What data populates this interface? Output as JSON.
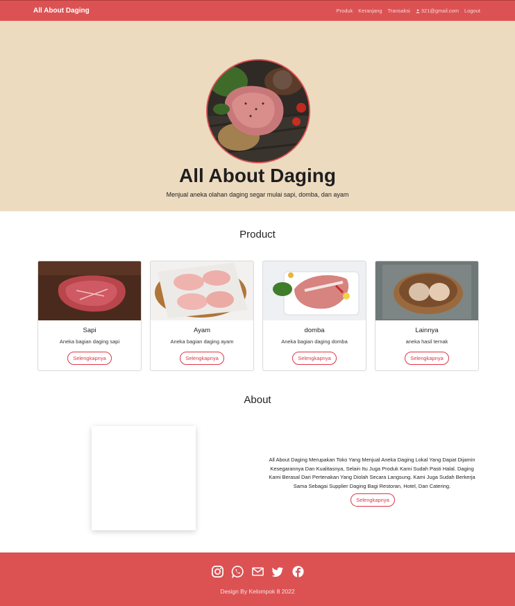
{
  "nav": {
    "brand": "All About Daging",
    "links": [
      "Produk",
      "Keranjang",
      "Transaksi"
    ],
    "user_email": "321@gmail.com",
    "logout": "Logout"
  },
  "hero": {
    "title": "All About Daging",
    "subtitle": "Menjual aneka olahan daging segar mulai sapi, domba, dan ayam"
  },
  "product": {
    "heading": "Product",
    "cards": [
      {
        "title": "Sapi",
        "desc": "Aneka bagian daging sapi",
        "button": "Selengkapnya"
      },
      {
        "title": "Ayam",
        "desc": "Aneka bagian daging ayam",
        "button": "Selengkapnya"
      },
      {
        "title": "domba",
        "desc": "Aneka bagian daging domba",
        "button": "Selengkapnya"
      },
      {
        "title": "Lainnya",
        "desc": "aneka hasil ternak",
        "button": "Selengkapnya"
      }
    ]
  },
  "about": {
    "heading": "About",
    "text": "All About Daging Merupakan Toko Yang Menjual Aneka Daging Lokal Yang Dapat Dijamin Kesegarannya Dan Kualitasnya, Selain Itu Juga Produk Kami Sudah Pasti Halal. Daging Kami Berasal Dari Pertenakan Yang Diolah Secara Langsung. Kami Juga Sudah Berkerja Sama Sebagai Supplier Daging Bagi Restoran, Hotel, Dan Catering.",
    "button": "Selengkapnya"
  },
  "footer": {
    "icons": [
      "instagram-icon",
      "whatsapp-icon",
      "mail-icon",
      "twitter-icon",
      "facebook-icon"
    ],
    "copyright": "Design By Kelompok 8 2022"
  },
  "colors": {
    "primary": "#dc5253",
    "hero_bg": "#eddbc0",
    "button_red": "#dc3545"
  }
}
